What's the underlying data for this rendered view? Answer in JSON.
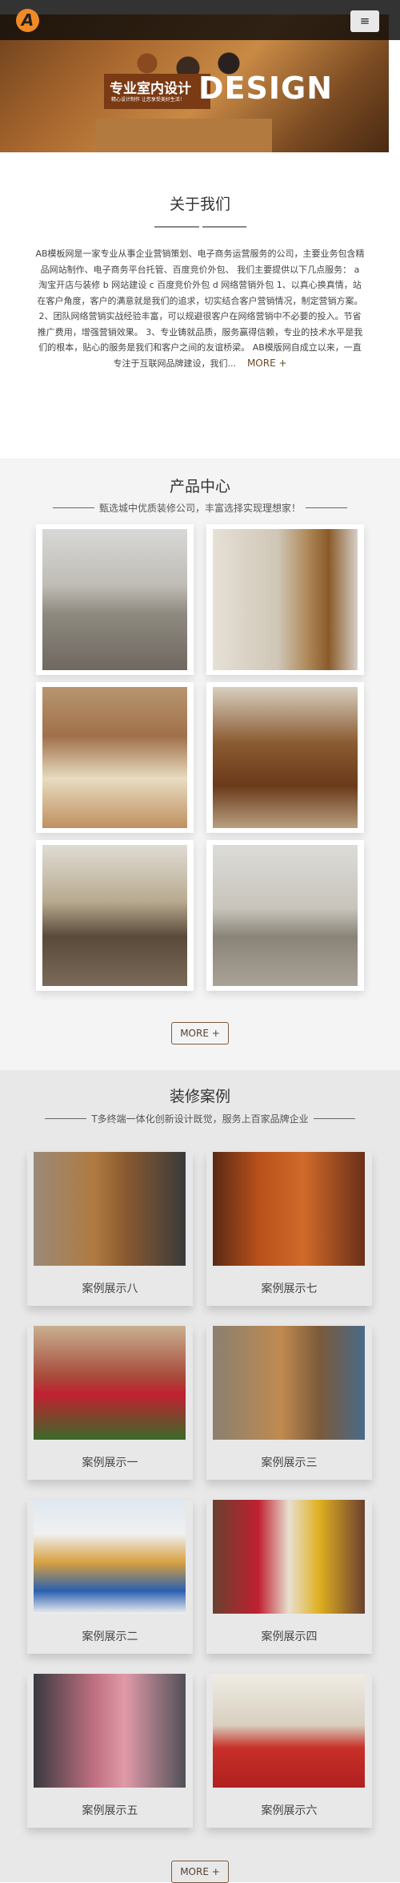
{
  "header": {
    "logo_letter": "A",
    "menu_icon": "hamburger-icon",
    "accent": "#f08a24"
  },
  "banner": {
    "title_cn": "专业室内设计",
    "subtitle_cn": "精心设计制作  让您享受美好生活！",
    "title_en": "DESIGN"
  },
  "about": {
    "title": "关于我们",
    "text": "AB模板网是一家专业从事企业营销策划、电子商务运营服务的公司，主要业务包含精品网站制作、电子商务平台托管、百度竞价外包、 我们主要提供以下几点服务： a 淘宝开店与装修 b 网站建设 c 百度竞价外包 d 网络营销外包 1、以真心换真情，站在客户角度，客户的满意就是我们的追求，切实结合客户营销情况，制定营销方案。 2、团队网络营销实战经验丰富，可以规避很客户在网络营销中不必要的投入。节省推广费用，增强营销效果。 3、专业铸就品质，服务赢得信赖，专业的技术水平是我们的根本，贴心的服务是我们和客户之间的友谊桥梁。 AB模版网自成立以来，一直专注于互联网品牌建设，我们...",
    "more": "MORE +"
  },
  "products": {
    "title": "产品中心",
    "subtitle": "甄选城中优质装修公司，丰富选择实现理想家！",
    "more": "MORE +",
    "items": [
      {
        "image": "living-room-1"
      },
      {
        "image": "living-room-tv-wall"
      },
      {
        "image": "bedroom"
      },
      {
        "image": "bar-counter"
      },
      {
        "image": "living-room-2"
      },
      {
        "image": "living-room-3"
      }
    ]
  },
  "cases": {
    "title": "装修案例",
    "subtitle": "T多终端一体化创新设计既觉，服务上百家品牌企业",
    "more": "MORE +",
    "items": [
      {
        "label": "案例展示八"
      },
      {
        "label": "案例展示七"
      },
      {
        "label": "案例展示一"
      },
      {
        "label": "案例展示三"
      },
      {
        "label": "案例展示二"
      },
      {
        "label": "案例展示四"
      },
      {
        "label": "案例展示五"
      },
      {
        "label": "案例展示六"
      }
    ]
  }
}
